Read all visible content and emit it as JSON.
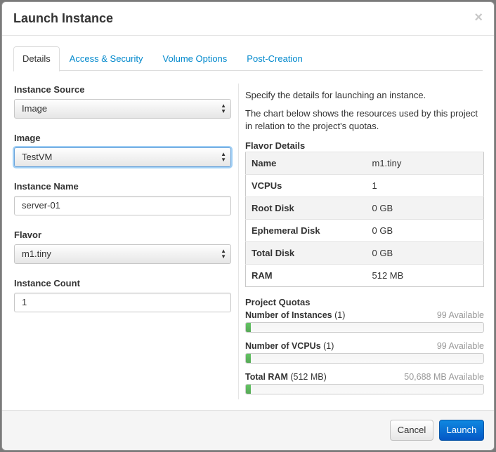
{
  "dialog": {
    "title": "Launch Instance",
    "close_symbol": "×"
  },
  "tabs": [
    {
      "label": "Details",
      "active": true
    },
    {
      "label": "Access & Security",
      "active": false
    },
    {
      "label": "Volume Options",
      "active": false
    },
    {
      "label": "Post-Creation",
      "active": false
    }
  ],
  "form": {
    "instance_source": {
      "label": "Instance Source",
      "value": "Image"
    },
    "image": {
      "label": "Image",
      "value": "TestVM"
    },
    "instance_name": {
      "label": "Instance Name",
      "value": "server-01"
    },
    "flavor": {
      "label": "Flavor",
      "value": "m1.tiny"
    },
    "instance_count": {
      "label": "Instance Count",
      "value": "1"
    }
  },
  "help": {
    "line1": "Specify the details for launching an instance.",
    "line2": "The chart below shows the resources used by this project in relation to the project's quotas."
  },
  "flavor_details": {
    "title": "Flavor Details",
    "rows": [
      {
        "key": "Name",
        "value": "m1.tiny"
      },
      {
        "key": "VCPUs",
        "value": "1"
      },
      {
        "key": "Root Disk",
        "value": "0 GB"
      },
      {
        "key": "Ephemeral Disk",
        "value": "0 GB"
      },
      {
        "key": "Total Disk",
        "value": "0 GB"
      },
      {
        "key": "RAM",
        "value": "512 MB"
      }
    ]
  },
  "quotas": {
    "title": "Project Quotas",
    "items": [
      {
        "name": "Number of Instances",
        "detail": " (1)",
        "available": "99 Available",
        "used_fraction": 0.01
      },
      {
        "name": "Number of VCPUs",
        "detail": " (1)",
        "available": "99 Available",
        "used_fraction": 0.01
      },
      {
        "name": "Total RAM",
        "detail": " (512 MB)",
        "available": "50,688 MB Available",
        "used_fraction": 0.01
      }
    ]
  },
  "footer": {
    "cancel_label": "Cancel",
    "launch_label": "Launch"
  },
  "colors": {
    "accent": "#0088cc",
    "launch_button": "#0558c6",
    "quota_fill": "#57a957"
  },
  "icons": {
    "close": "close-icon",
    "select_arrows": "select-arrows-icon"
  }
}
